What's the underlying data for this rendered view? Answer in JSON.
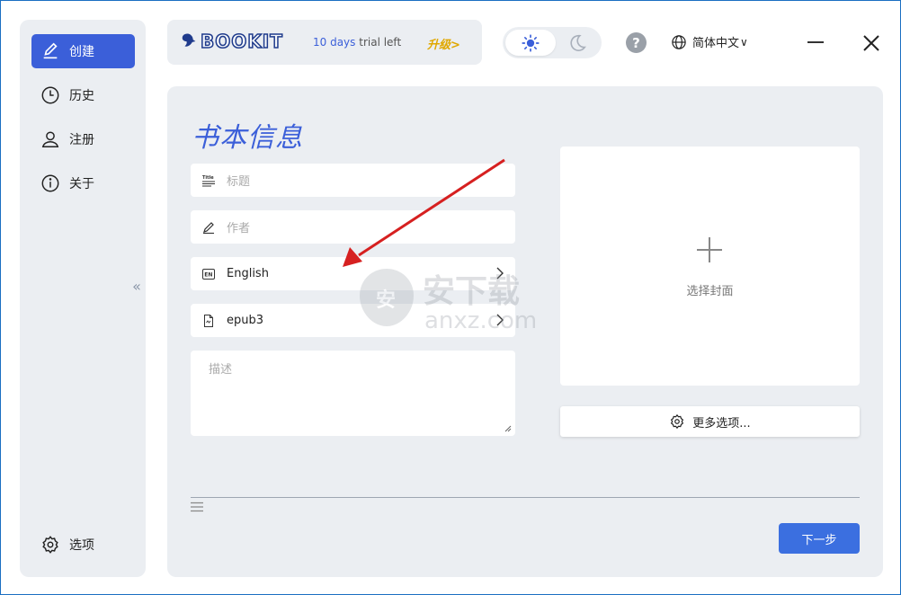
{
  "sidebar": {
    "items": [
      {
        "label": "创建",
        "icon": "pencil-icon",
        "active": true
      },
      {
        "label": "历史",
        "icon": "clock-icon",
        "active": false
      },
      {
        "label": "注册",
        "icon": "user-icon",
        "active": false
      },
      {
        "label": "关于",
        "icon": "info-icon",
        "active": false
      }
    ],
    "settings_label": "选项",
    "collapse_glyph": "«"
  },
  "brand": {
    "logo_text": "BOOKIT",
    "trial_days": "10 days",
    "trial_suffix": " trial left",
    "upgrade_label": "升级>"
  },
  "header": {
    "help_glyph": "?",
    "language_label": "简体中文",
    "language_chevron": "∨",
    "theme": "light"
  },
  "form": {
    "title": "书本信息",
    "title_placeholder": "标题",
    "author_placeholder": "作者",
    "language_value": "English",
    "format_value": "epub3",
    "description_placeholder": "描述",
    "cover_label": "选择封面",
    "more_options_label": "更多选项...",
    "next_label": "下一步"
  },
  "watermark": {
    "text_cn": "安下载",
    "text_en": "anxz.com"
  },
  "colors": {
    "accent": "#3b5fd9",
    "primary_button": "#3b6fe0",
    "panel_bg": "#ebeef2",
    "upgrade": "#e0a800",
    "annotation_arrow": "#d62020"
  }
}
